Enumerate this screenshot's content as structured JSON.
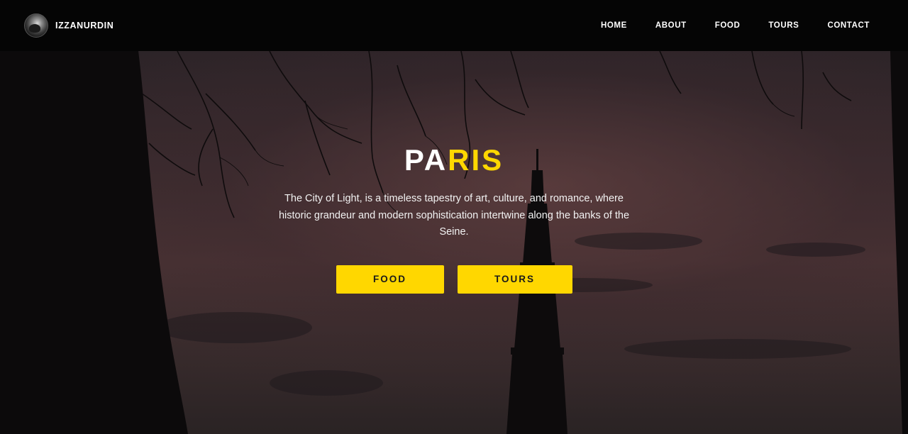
{
  "brand": {
    "name": "IZZANURDIN",
    "avatar": "profile-avatar"
  },
  "nav": {
    "items": [
      {
        "label": "HOME"
      },
      {
        "label": "ABOUT"
      },
      {
        "label": "FOOD"
      },
      {
        "label": "TOURS"
      },
      {
        "label": "CONTACT"
      }
    ]
  },
  "hero": {
    "title_part1": "PA",
    "title_part2": "RIS",
    "description": "The City of Light, is a timeless tapestry of art, culture, and romance, where historic grandeur and modern sophistication intertwine along the banks of the Seine.",
    "buttons": [
      {
        "label": "FOOD"
      },
      {
        "label": "TOURS"
      }
    ]
  },
  "colors": {
    "accent": "#ffd700",
    "nav_bg": "#050505",
    "text": "#ffffff"
  }
}
